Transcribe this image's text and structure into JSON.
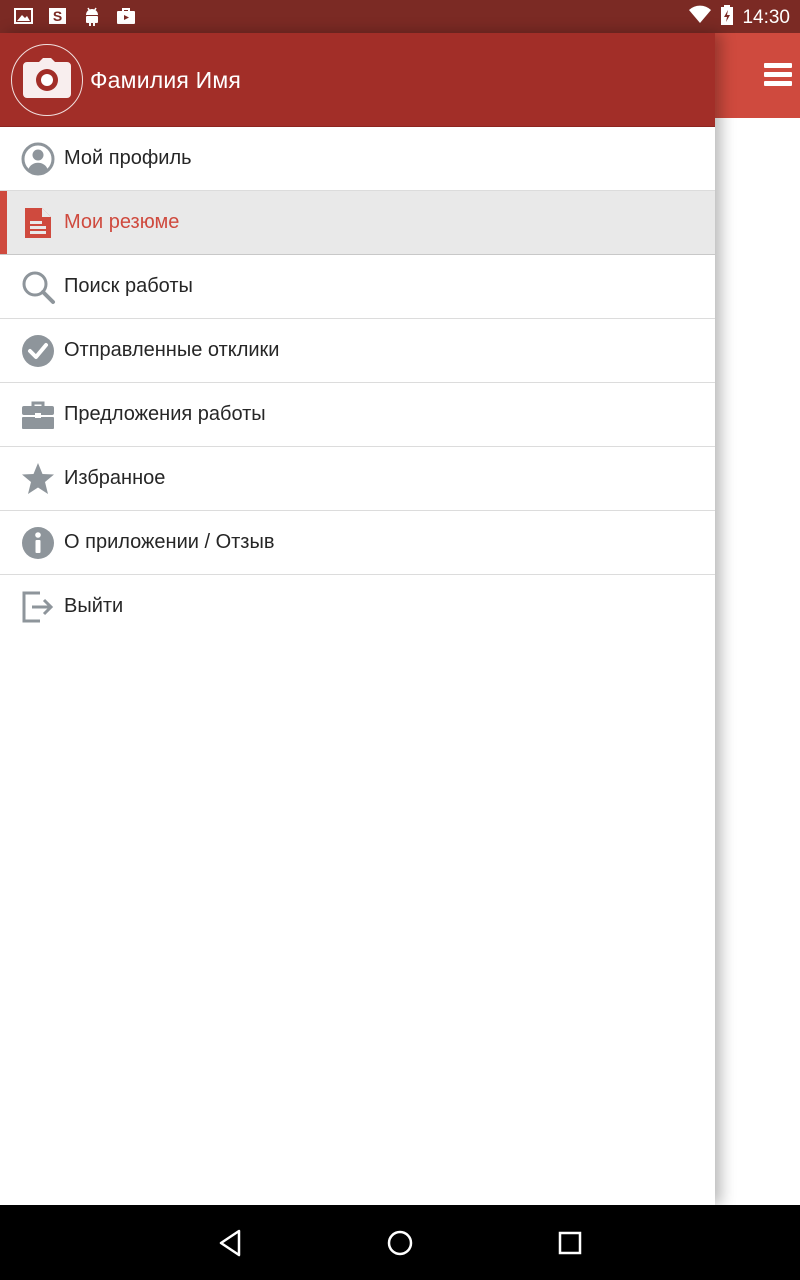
{
  "status_bar": {
    "time": "14:30",
    "icons": [
      "image-icon",
      "s-app-icon",
      "android-icon",
      "store-icon",
      "wifi-icon",
      "battery-icon"
    ]
  },
  "drawer": {
    "header": {
      "avatar_icon": "camera-icon",
      "user_name": "Фамилия Имя"
    },
    "items": [
      {
        "label": "Мой профиль",
        "icon": "profile-icon",
        "active": false
      },
      {
        "label": "Мои резюме",
        "icon": "document-icon",
        "active": true
      },
      {
        "label": "Поиск работы",
        "icon": "search-icon",
        "active": false
      },
      {
        "label": "Отправленные отклики",
        "icon": "check-circle-icon",
        "active": false
      },
      {
        "label": "Предложения работы",
        "icon": "briefcase-icon",
        "active": false
      },
      {
        "label": "Избранное",
        "icon": "star-icon",
        "active": false
      },
      {
        "label": "О приложении / Отзыв",
        "icon": "info-icon",
        "active": false
      },
      {
        "label": "Выйти",
        "icon": "logout-icon",
        "active": false
      }
    ]
  },
  "app_toolbar": {
    "menu_icon": "hamburger-menu-icon"
  },
  "nav_bar": {
    "icons": [
      "back-icon",
      "home-icon",
      "recents-icon"
    ]
  },
  "colors": {
    "status_bar": "#7b2a24",
    "drawer_header": "#a22e28",
    "accent": "#cf4a3e",
    "icon_gray": "#8e959b",
    "active_background": "#e9e9e9"
  }
}
